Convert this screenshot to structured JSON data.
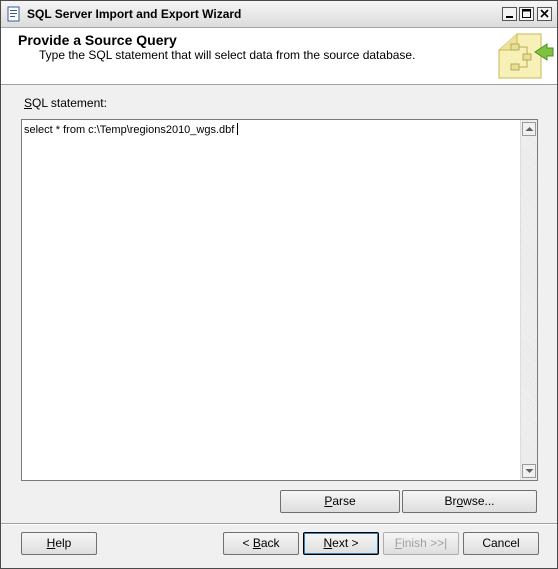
{
  "window": {
    "title": "SQL Server Import and Export Wizard"
  },
  "header": {
    "title": "Provide a Source Query",
    "subtitle": "Type the SQL statement that will select data from the source database."
  },
  "sql": {
    "label_prefix": "",
    "label_mnemonic": "S",
    "label_rest": "QL statement:",
    "value": "select * from c:\\Temp\\regions2010_wgs.dbf"
  },
  "buttons": {
    "parse": {
      "mnemonic": "P",
      "rest": "arse"
    },
    "browse": {
      "prefix": "Br",
      "mnemonic": "o",
      "rest": "wse..."
    },
    "help": {
      "mnemonic": "H",
      "rest": "elp"
    },
    "back": {
      "prefix": "< ",
      "mnemonic": "B",
      "rest": "ack"
    },
    "next": {
      "mnemonic": "N",
      "rest": "ext >"
    },
    "finish": {
      "mnemonic": "F",
      "rest": "inish >>|"
    },
    "cancel": {
      "label": "Cancel"
    }
  },
  "icons": {
    "app": "wizard-app-icon",
    "minimize": "minimize-icon",
    "maximize": "maximize-icon",
    "close": "close-icon",
    "header_graphic": "data-transfer-graphic"
  }
}
